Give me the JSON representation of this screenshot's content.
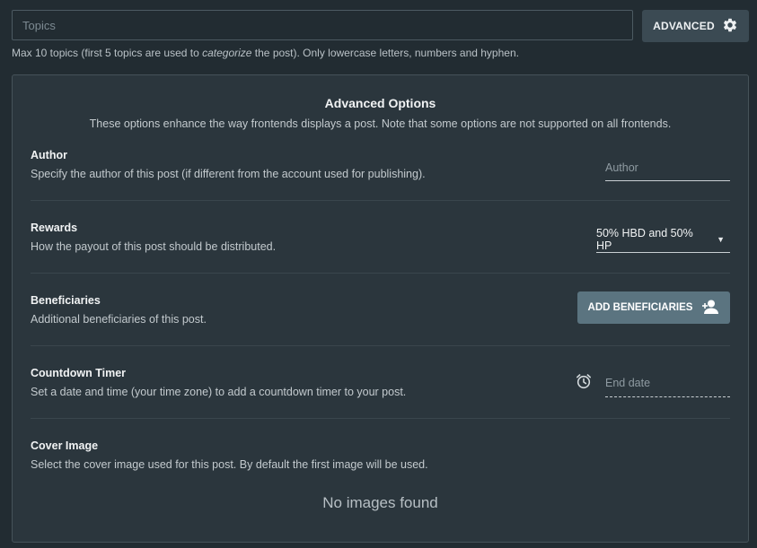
{
  "topics": {
    "placeholder": "Topics",
    "advanced_label": "ADVANCED",
    "hint_before": "Max 10 topics (first 5 topics are used to ",
    "hint_emphasis": "categorize",
    "hint_after": " the post). Only lowercase letters, numbers and hyphen."
  },
  "panel": {
    "title": "Advanced Options",
    "subtitle": "These options enhance the way frontends displays a post. Note that some options are not supported on all frontends.",
    "author": {
      "title": "Author",
      "description": "Specify the author of this post (if different from the account used for publishing).",
      "placeholder": "Author"
    },
    "rewards": {
      "title": "Rewards",
      "description": "How the payout of this post should be distributed.",
      "selected": "50% HBD and 50% HP"
    },
    "beneficiaries": {
      "title": "Beneficiaries",
      "description": "Additional beneficiaries of this post.",
      "button_label": "ADD BENEFICIARIES"
    },
    "countdown": {
      "title": "Countdown Timer",
      "description": "Set a date and time (your time zone) to add a countdown timer to your post.",
      "placeholder": "End date"
    },
    "cover": {
      "title": "Cover Image",
      "description": "Select the cover image used for this post. By default the first image will be used.",
      "empty_text": "No images found"
    }
  },
  "icons": {
    "advanced": "gear-icon",
    "beneficiaries": "add-user-icon",
    "countdown": "alarm-clock-icon",
    "rewards_dropdown": "caret-down-icon"
  },
  "colors": {
    "background": "#222c32",
    "panel": "#2b363d",
    "button": "#3b4a53",
    "accent_button": "#5b7480"
  }
}
